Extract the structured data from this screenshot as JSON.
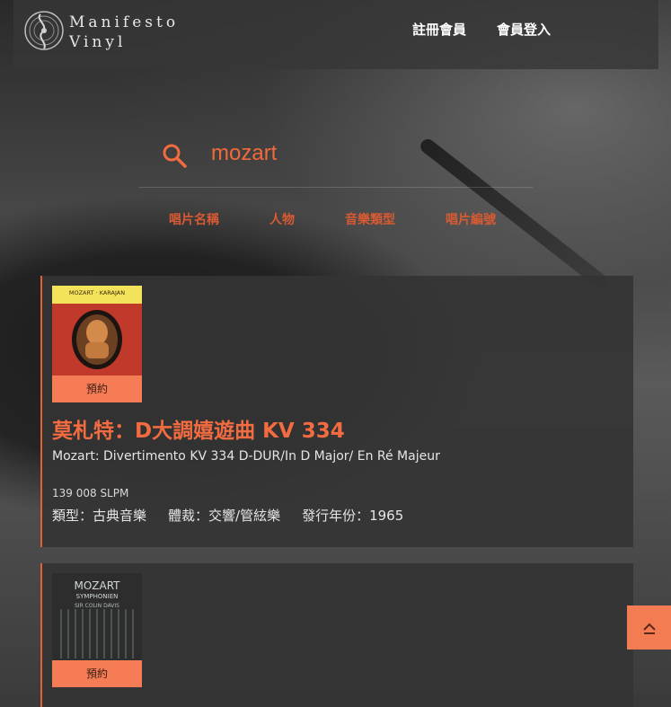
{
  "brand": {
    "line1": "Manifesto",
    "line2": "Vinyl"
  },
  "nav": {
    "register": "註冊會員",
    "login": "會員登入"
  },
  "search": {
    "value": "mozart"
  },
  "filters": [
    "唱片名稱",
    "人物",
    "音樂類型",
    "唱片編號"
  ],
  "results": [
    {
      "badge": "預約",
      "cover_text_top": "MOZART · KARAJAN",
      "title": "莫札特：D大調嬉遊曲 KV 334",
      "subtitle": "Mozart: Divertimento KV 334 D-DUR/In D Major/ En Ré Majeur",
      "catalog": "139 008 SLPM",
      "type": "類型：古典音樂",
      "genre": "體裁：交響/管絃樂",
      "year": "發行年份：1965"
    },
    {
      "badge": "預約",
      "cover_lines": [
        "MOZART",
        "SYMPHONIEN",
        "SIR COLIN DAVIS"
      ]
    }
  ],
  "colors": {
    "accent": "#f36b40",
    "badge": "#f57c54"
  },
  "icons": {
    "search": "search-icon",
    "back_to_top": "chevron-up-icon"
  }
}
